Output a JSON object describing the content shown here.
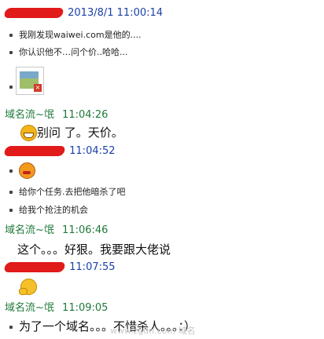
{
  "messages": [
    {
      "time": "2013/8/1 11:00:14"
    },
    {
      "name": "域名流~氓",
      "time": "11:04:26"
    },
    {
      "time": "11:04:52"
    },
    {
      "name": "域名流~氓",
      "time": "11:06:46"
    },
    {
      "time": "11:07:55"
    },
    {
      "name": "域名流~氓",
      "time": "11:09:05"
    }
  ],
  "lines": {
    "m1a": "我刚发现waiwei.com是他的....",
    "m1b": "你认识他不…问个价..哈哈...",
    "m2": "别问 了。天价。",
    "m3a": "给你个任务.去把他暗杀了吧",
    "m3b": "给我个抢注的机会",
    "m4": "这个。。。好狠。我要跟大佬说",
    "m5": "为了一个域名。。。不惜杀人。。。：）"
  },
  "icons": {
    "grin": "grinning-face-icon",
    "angry": "angry-face-icon",
    "think": "thinking-face-icon",
    "broken_image": "broken-image-icon"
  },
  "watermark": "www.zgdn.com  域名"
}
